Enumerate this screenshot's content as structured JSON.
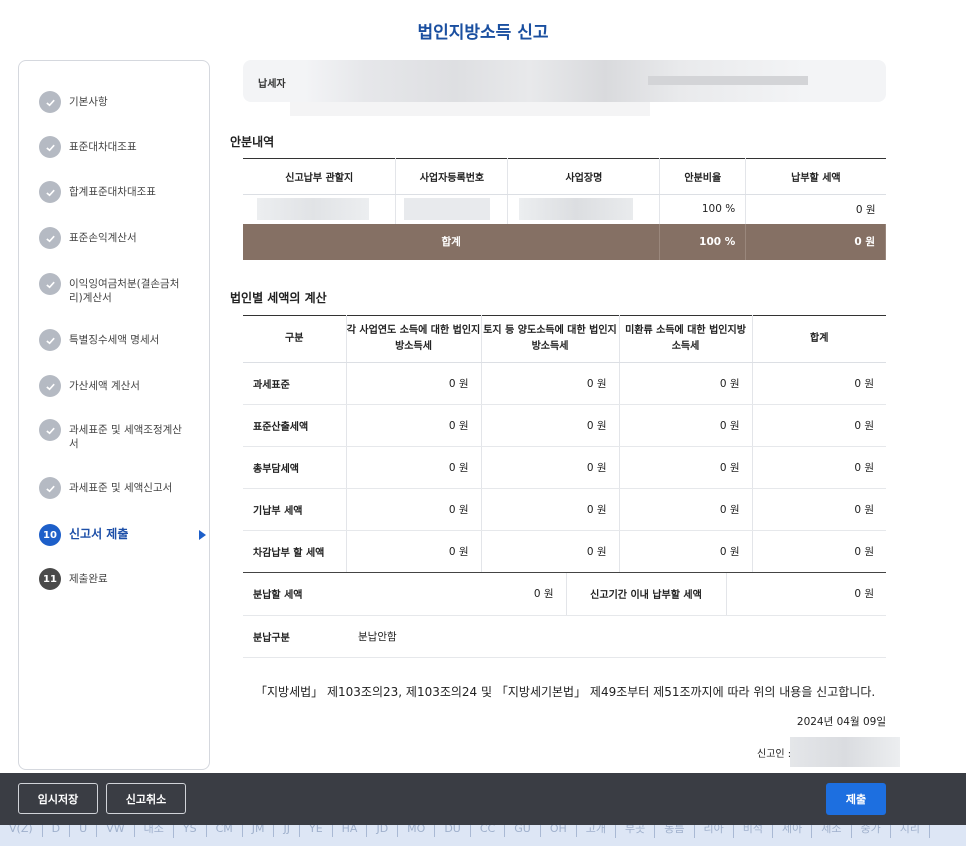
{
  "page_title": "법인지방소득 신고",
  "steps": [
    {
      "num": "",
      "label": "기본사항",
      "state": "done"
    },
    {
      "num": "",
      "label": "표준대차대조표",
      "state": "done"
    },
    {
      "num": "",
      "label": "합계표준대차대조표",
      "state": "done"
    },
    {
      "num": "",
      "label": "표준손익계산서",
      "state": "done"
    },
    {
      "num": "",
      "label": "이익잉여금처분(결손금처리)계산서",
      "state": "done"
    },
    {
      "num": "",
      "label": "특별징수세액 명세서",
      "state": "done"
    },
    {
      "num": "",
      "label": "가산세액 계산서",
      "state": "done"
    },
    {
      "num": "",
      "label": "과세표준 및 세액조정계산서",
      "state": "done"
    },
    {
      "num": "",
      "label": "과세표준 및 세액신고서",
      "state": "done"
    },
    {
      "num": "10",
      "label": "신고서 제출",
      "state": "current"
    },
    {
      "num": "11",
      "label": "제출완료",
      "state": "todo"
    }
  ],
  "taxpayer": {
    "label": "납세자"
  },
  "allocation": {
    "title": "안분내역",
    "headers": [
      "신고납부 관할지",
      "사업자등록번호",
      "사업장명",
      "안분비율",
      "납부할 세액"
    ],
    "row": {
      "ratio": "100 %",
      "tax": "0 원"
    },
    "total": {
      "label": "합계",
      "ratio": "100 %",
      "tax": "0 원"
    }
  },
  "calc": {
    "title": "법인별 세액의 계산",
    "headers": [
      "구분",
      "각 사업연도 소득에 대한 법인지방소득세",
      "토지 등 양도소득에 대한 법인지방소득세",
      "미환류 소득에 대한 법인지방 소득세",
      "합계"
    ],
    "rows": [
      {
        "label": "과세표준",
        "v1": "0 원",
        "v2": "0 원",
        "v3": "0 원",
        "v4": "0 원"
      },
      {
        "label": "표준산출세액",
        "v1": "0 원",
        "v2": "0 원",
        "v3": "0 원",
        "v4": "0 원"
      },
      {
        "label": "총부담세액",
        "v1": "0 원",
        "v2": "0 원",
        "v3": "0 원",
        "v4": "0 원"
      },
      {
        "label": "기납부 세액",
        "v1": "0 원",
        "v2": "0 원",
        "v3": "0 원",
        "v4": "0 원"
      },
      {
        "label": "차감납부 할 세액",
        "v1": "0 원",
        "v2": "0 원",
        "v3": "0 원",
        "v4": "0 원"
      }
    ]
  },
  "installment": {
    "label": "분납할 세액",
    "value": "0 원",
    "due_label": "신고기간 이내 납부할 세액",
    "due_value": "0 원",
    "type_label": "분납구분",
    "type_value": "분납안함"
  },
  "law_text": "「지방세법」 제103조의23, 제103조의24 및 「지방세기본법」 제49조부터 제51조까지에 따라 위의 내용을 신고합니다.",
  "date": "2024년 04월 09일",
  "signer_label": "신고인 : ",
  "footer": {
    "temp_save": "임시저장",
    "cancel": "신고취소",
    "submit": "제출"
  },
  "bottom_strip": [
    "V(Z)",
    "D",
    "U",
    "VW",
    "대소",
    "YS",
    "CM",
    "JM",
    "JJ",
    "YE",
    "HA",
    "JD",
    "MO",
    "DU",
    "CC",
    "GU",
    "OH",
    "고개",
    "부곳",
    "동름",
    "리아",
    "비석",
    "세아",
    "제소",
    "중가",
    "지리"
  ],
  "accent_color": "#1d5fc9",
  "total_row_color": "#857064"
}
